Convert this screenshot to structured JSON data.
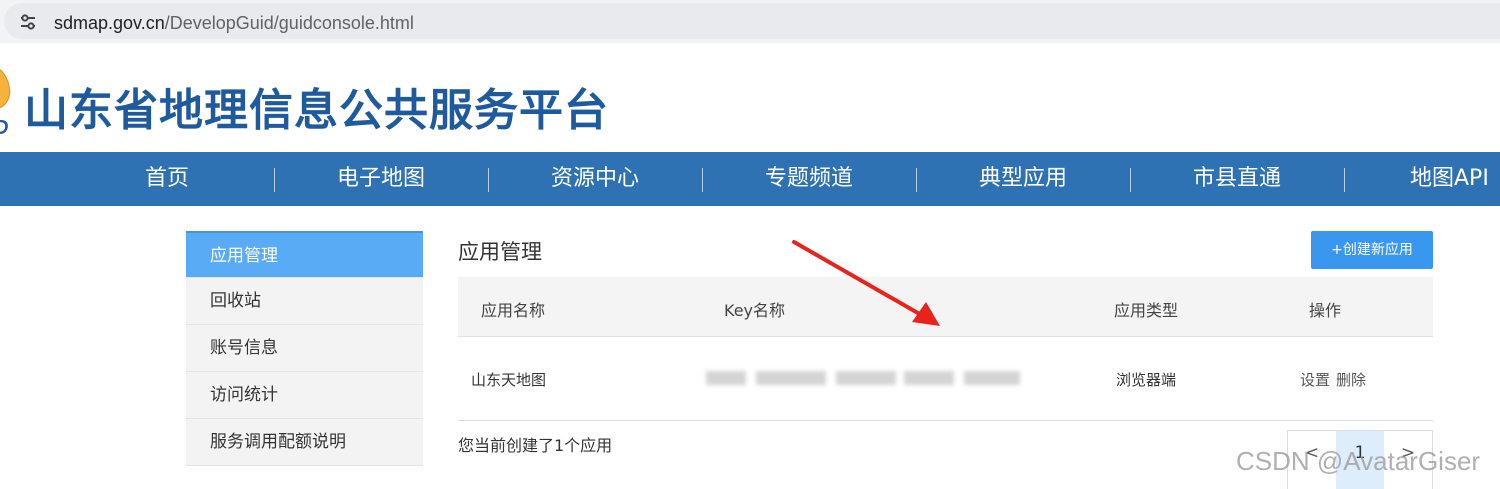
{
  "browser": {
    "url_host": "sdmap.gov.cn",
    "url_path": "/DevelopGuid/guidconsole.html",
    "site_info_icon": "tune-icon"
  },
  "header": {
    "title": "山东省地理信息公共服务平台",
    "logo_icon": "sd-logo-icon"
  },
  "nav": {
    "items": [
      {
        "label": "首页"
      },
      {
        "label": "电子地图"
      },
      {
        "label": "资源中心"
      },
      {
        "label": "专题频道"
      },
      {
        "label": "典型应用"
      },
      {
        "label": "市县直通"
      },
      {
        "label": "地图API"
      }
    ]
  },
  "sidebar": {
    "items": [
      {
        "label": "应用管理",
        "active": true
      },
      {
        "label": "回收站"
      },
      {
        "label": "账号信息"
      },
      {
        "label": "访问统计"
      },
      {
        "label": "服务调用配额说明"
      }
    ]
  },
  "main": {
    "title": "应用管理",
    "create_button": "+创建新应用",
    "table": {
      "headers": [
        "应用名称",
        "Key名称",
        "应用类型",
        "操作"
      ],
      "rows": [
        {
          "name": "山东天地图",
          "type": "浏览器端",
          "actions": [
            "设置",
            "删除"
          ]
        }
      ]
    },
    "count_text": "您当前创建了1个应用",
    "pagination": {
      "prev": "<",
      "current": "1",
      "next": ">"
    }
  },
  "watermark": "CSDN @AvatarGiser",
  "colors": {
    "nav_bg": "#2e72b3",
    "sidebar_active": "#5aabf5",
    "button": "#3a97ef",
    "title": "#1f5a9d",
    "annotation_arrow": "#e8231c"
  }
}
